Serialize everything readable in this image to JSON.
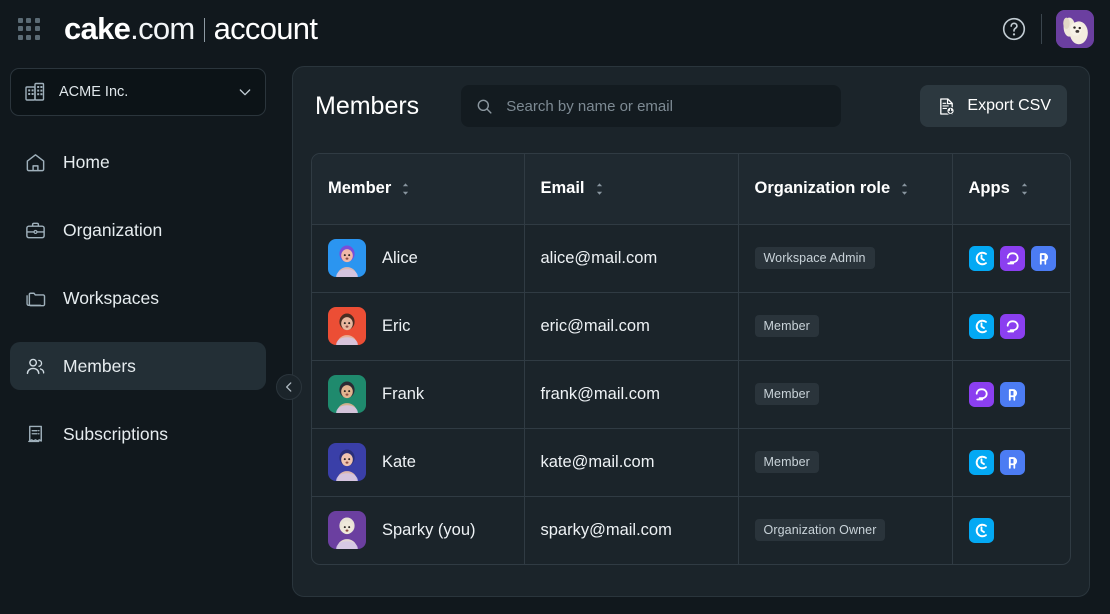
{
  "topbar": {
    "launcher_icon": "grid-apps-icon",
    "brand": {
      "primary": "cake",
      "domain": ".com",
      "product": "account"
    },
    "help_icon": "help-circle-icon",
    "avatar_alt": "Sparky"
  },
  "sidebar": {
    "org_selector": {
      "label": "ACME Inc.",
      "icon": "building-icon",
      "chevron": "chevron-down-icon"
    },
    "items": [
      {
        "label": "Home",
        "icon": "home-icon",
        "active": false
      },
      {
        "label": "Organization",
        "icon": "briefcase-icon",
        "active": false
      },
      {
        "label": "Workspaces",
        "icon": "folders-icon",
        "active": false
      },
      {
        "label": "Members",
        "icon": "people-icon",
        "active": true
      },
      {
        "label": "Subscriptions",
        "icon": "receipt-icon",
        "active": false
      }
    ],
    "collapse_icon": "chevron-left-icon"
  },
  "main": {
    "title": "Members",
    "search": {
      "placeholder": "Search by name or email",
      "value": "",
      "icon": "search-icon"
    },
    "export": {
      "label": "Export CSV",
      "icon": "file-export-icon"
    },
    "table": {
      "columns": [
        {
          "label": "Member",
          "sortable": true
        },
        {
          "label": "Email",
          "sortable": true
        },
        {
          "label": "Organization role",
          "sortable": true
        },
        {
          "label": "Apps",
          "sortable": true
        }
      ],
      "rows": [
        {
          "name": "Alice",
          "email": "alice@mail.com",
          "role": "Workspace Admin",
          "avatar_bg": "#2b95f0",
          "avatar_hair": "#7a4ed8",
          "avatar_skin": "#f0b9a8",
          "apps": [
            "clockify",
            "pumble",
            "plaky"
          ]
        },
        {
          "name": "Eric",
          "email": "eric@mail.com",
          "role": "Member",
          "avatar_bg": "#ec4e35",
          "avatar_hair": "#4a2d22",
          "avatar_skin": "#e8b79f",
          "apps": [
            "clockify",
            "pumble"
          ]
        },
        {
          "name": "Frank",
          "email": "frank@mail.com",
          "role": "Member",
          "avatar_bg": "#1f8a6d",
          "avatar_hair": "#2b2b33",
          "avatar_skin": "#e2b48f",
          "apps": [
            "pumble",
            "plaky"
          ]
        },
        {
          "name": "Kate",
          "email": "kate@mail.com",
          "role": "Member",
          "avatar_bg": "#3a3fa8",
          "avatar_hair": "#2a2f78",
          "avatar_skin": "#f0c4ae",
          "apps": [
            "clockify",
            "plaky"
          ]
        },
        {
          "name": "Sparky (you)",
          "email": "sparky@mail.com",
          "role": "Organization Owner",
          "avatar_bg": "#6b3fa0",
          "avatar_hair": "#e9e3d6",
          "avatar_skin": "#efe8da",
          "apps": [
            "clockify"
          ]
        }
      ]
    }
  },
  "colors": {
    "page_bg": "#11181d",
    "panel_bg": "#1b242a",
    "border": "#303b43",
    "accent_clockify": "#03a9f4",
    "accent_pumble": "#8b3ff0",
    "accent_plaky": "#4c7cf3",
    "badge_bg": "#2a343b",
    "text_primary": "#eef2f5",
    "text_muted": "#7d8a93"
  }
}
